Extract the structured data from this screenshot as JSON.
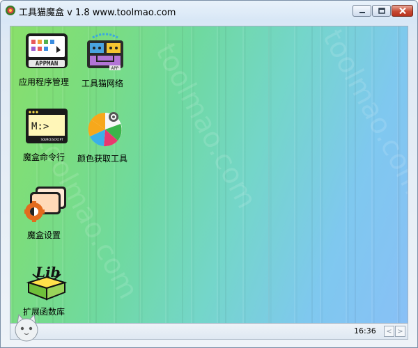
{
  "window": {
    "title": "工具猫魔盒 v 1.8 www.toolmao.com"
  },
  "desktop": {
    "watermark": "toolmao.com",
    "icons": [
      {
        "label": "应用程序管理",
        "icon": "appman-icon",
        "badge": "APPMAN"
      },
      {
        "label": "工具猫网络",
        "icon": "network-icon",
        "badge": "APP"
      },
      {
        "label": "魔盒命令行",
        "icon": "terminal-icon",
        "badge": "M:>",
        "sub": "SOURCESCRIPT"
      },
      {
        "label": "颜色获取工具",
        "icon": "color-picker-icon"
      },
      {
        "label": "魔盒设置",
        "icon": "settings-icon"
      },
      {
        "label": "扩展函数库",
        "icon": "library-icon",
        "badge": "Lib"
      }
    ]
  },
  "statusbar": {
    "time": "16:36",
    "prev": "<",
    "next": ">"
  },
  "colors": {
    "accent": "#6fd9a0",
    "close": "#c74a34"
  }
}
